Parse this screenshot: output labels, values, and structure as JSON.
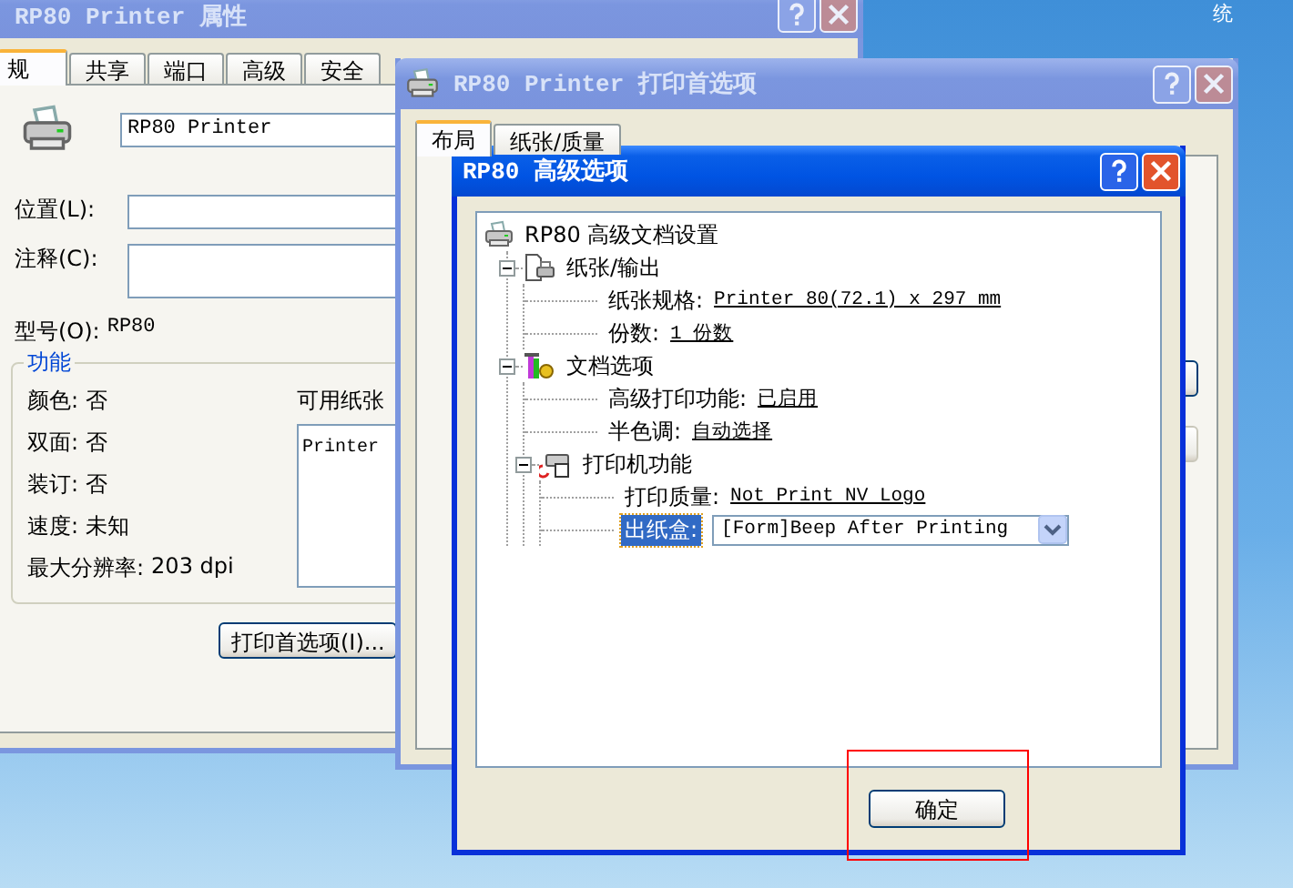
{
  "desktop": {
    "text": "统"
  },
  "properties_window": {
    "title": "RP80 Printer 属性",
    "active": false,
    "tabs": [
      {
        "label": "规",
        "selected": true
      },
      {
        "label": "共享",
        "selected": false
      },
      {
        "label": "端口",
        "selected": false
      },
      {
        "label": "高级",
        "selected": false
      },
      {
        "label": "安全",
        "selected": false
      }
    ],
    "printer_name": "RP80 Printer",
    "fields": [
      {
        "label": "位置(L):",
        "multiline": false
      },
      {
        "label": "注释(C):",
        "multiline": true
      }
    ],
    "model": {
      "label": "型号(O):",
      "value": "RP80"
    },
    "features": {
      "title": "功能",
      "items": [
        {
          "label": "颜色:",
          "value": "否"
        },
        {
          "label": "双面:",
          "value": "否"
        },
        {
          "label": "装订:",
          "value": "否"
        },
        {
          "label": "速度:",
          "value": "未知"
        },
        {
          "label": "最大分辨率:",
          "value": "203 dpi"
        }
      ],
      "paper_label": "可用纸张",
      "paper_list": [
        "Printer"
      ]
    },
    "button": "打印首选项(I)..."
  },
  "preferences_window": {
    "title": "RP80 Printer 打印首选项",
    "active": false,
    "tabs": [
      {
        "label": "布局",
        "selected": true
      },
      {
        "label": "纸张/质量",
        "selected": false
      }
    ]
  },
  "advanced_window": {
    "title": "RP80 高级选项",
    "active": true,
    "tree": {
      "kind": "root",
      "label": "RP80 高级文档设置",
      "selected": false,
      "children": [
        {
          "kind": "group",
          "label": "纸张/输出",
          "expanded": true,
          "selected": false,
          "children": [
            {
              "kind": "setting",
              "label": "纸张规格:",
              "value": "Printer 80(72.1) x 297 mm",
              "selected": false
            },
            {
              "kind": "setting",
              "label": "份数:",
              "value": "1 份数",
              "selected": false
            }
          ]
        },
        {
          "kind": "group",
          "label": "文档选项",
          "expanded": true,
          "selected": false,
          "children": [
            {
              "kind": "setting",
              "label": "高级打印功能:",
              "value": "已启用",
              "selected": false
            },
            {
              "kind": "setting",
              "label": "半色调:",
              "value": "自动选择",
              "selected": false
            },
            {
              "kind": "group",
              "label": "打印机功能",
              "expanded": true,
              "selected": false,
              "children": [
                {
                  "kind": "setting",
                  "label": "打印质量:",
                  "value": "Not Print NV Logo",
                  "selected": false
                },
                {
                  "kind": "dropdown",
                  "label": "出纸盒:",
                  "value": "[Form]Beep After Printing",
                  "selected": true
                }
              ]
            }
          ]
        }
      ]
    },
    "ok_button": "确定"
  }
}
